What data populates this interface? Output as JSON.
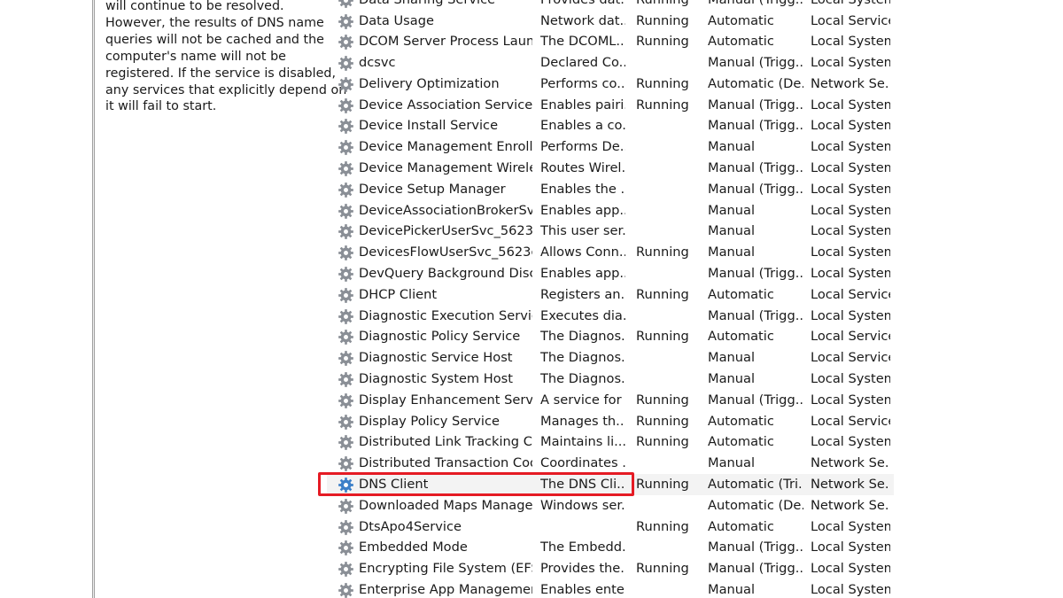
{
  "description_pane": {
    "lines": [
      "will continue to be resolved.",
      "However, the results of DNS name",
      "queries will not be cached and the",
      "computer's name will not be",
      "registered. If the service is disabled,",
      "any services that explicitly depend on",
      "it will fail to start."
    ]
  },
  "colors": {
    "highlight_border": "#e51b24",
    "selected_row_bg": "#f3f3f3",
    "gear_blue": "#3c7fc8",
    "gear_gray": "#8a8f96"
  },
  "services": [
    {
      "name": "Data Sharing Service",
      "description": "Provides dat...",
      "status": "Running",
      "startup": "Manual (Trigg...",
      "logon": "Local System",
      "icon": "gear-icon"
    },
    {
      "name": "Data Usage",
      "description": "Network dat...",
      "status": "Running",
      "startup": "Automatic",
      "logon": "Local Service",
      "icon": "gear-icon"
    },
    {
      "name": "DCOM Server Process Launc...",
      "description": "The DCOML...",
      "status": "Running",
      "startup": "Automatic",
      "logon": "Local System",
      "icon": "gear-icon"
    },
    {
      "name": "dcsvc",
      "description": "Declared Co...",
      "status": "",
      "startup": "Manual (Trigg...",
      "logon": "Local System",
      "icon": "gear-icon"
    },
    {
      "name": "Delivery Optimization",
      "description": "Performs co...",
      "status": "Running",
      "startup": "Automatic (De...",
      "logon": "Network Se...",
      "icon": "gear-icon"
    },
    {
      "name": "Device Association Service",
      "description": "Enables pairi...",
      "status": "Running",
      "startup": "Manual (Trigg...",
      "logon": "Local System",
      "icon": "gear-icon"
    },
    {
      "name": "Device Install Service",
      "description": "Enables a co...",
      "status": "",
      "startup": "Manual (Trigg...",
      "logon": "Local System",
      "icon": "gear-icon"
    },
    {
      "name": "Device Management Enroll...",
      "description": "Performs De...",
      "status": "",
      "startup": "Manual",
      "logon": "Local System",
      "icon": "gear-icon"
    },
    {
      "name": "Device Management Wireles...",
      "description": "Routes Wirel...",
      "status": "",
      "startup": "Manual (Trigg...",
      "logon": "Local System",
      "icon": "gear-icon"
    },
    {
      "name": "Device Setup Manager",
      "description": "Enables the ...",
      "status": "",
      "startup": "Manual (Trigg...",
      "logon": "Local System",
      "icon": "gear-icon"
    },
    {
      "name": "DeviceAssociationBrokerSvc...",
      "description": "Enables app...",
      "status": "",
      "startup": "Manual",
      "logon": "Local System",
      "icon": "gear-icon"
    },
    {
      "name": "DevicePickerUserSvc_5623c",
      "description": "This user ser...",
      "status": "",
      "startup": "Manual",
      "logon": "Local System",
      "icon": "gear-icon"
    },
    {
      "name": "DevicesFlowUserSvc_5623c",
      "description": "Allows Conn...",
      "status": "Running",
      "startup": "Manual",
      "logon": "Local System",
      "icon": "gear-icon"
    },
    {
      "name": "DevQuery Background Disc...",
      "description": "Enables app...",
      "status": "",
      "startup": "Manual (Trigg...",
      "logon": "Local System",
      "icon": "gear-icon"
    },
    {
      "name": "DHCP Client",
      "description": "Registers an...",
      "status": "Running",
      "startup": "Automatic",
      "logon": "Local Service",
      "icon": "gear-icon"
    },
    {
      "name": "Diagnostic Execution Service",
      "description": "Executes dia...",
      "status": "",
      "startup": "Manual (Trigg...",
      "logon": "Local System",
      "icon": "gear-icon"
    },
    {
      "name": "Diagnostic Policy Service",
      "description": "The Diagnos...",
      "status": "Running",
      "startup": "Automatic",
      "logon": "Local Service",
      "icon": "gear-icon"
    },
    {
      "name": "Diagnostic Service Host",
      "description": "The Diagnos...",
      "status": "",
      "startup": "Manual",
      "logon": "Local Service",
      "icon": "gear-icon"
    },
    {
      "name": "Diagnostic System Host",
      "description": "The Diagnos...",
      "status": "",
      "startup": "Manual",
      "logon": "Local System",
      "icon": "gear-icon"
    },
    {
      "name": "Display Enhancement Service",
      "description": "A service for ...",
      "status": "Running",
      "startup": "Manual (Trigg...",
      "logon": "Local System",
      "icon": "gear-icon"
    },
    {
      "name": "Display Policy Service",
      "description": "Manages th...",
      "status": "Running",
      "startup": "Automatic",
      "logon": "Local Service",
      "icon": "gear-icon"
    },
    {
      "name": "Distributed Link Tracking Cli...",
      "description": "Maintains li...",
      "status": "Running",
      "startup": "Automatic",
      "logon": "Local System",
      "icon": "gear-icon"
    },
    {
      "name": "Distributed Transaction Coor...",
      "description": "Coordinates ...",
      "status": "",
      "startup": "Manual",
      "logon": "Network Se...",
      "icon": "gear-icon"
    },
    {
      "name": "DNS Client",
      "description": "The DNS Cli...",
      "status": "Running",
      "startup": "Automatic (Tri...",
      "logon": "Network Se...",
      "icon": "gear-icon",
      "selected": true
    },
    {
      "name": "Downloaded Maps Manager",
      "description": "Windows ser...",
      "status": "",
      "startup": "Automatic (De...",
      "logon": "Network Se...",
      "icon": "gear-icon"
    },
    {
      "name": "DtsApo4Service",
      "description": "",
      "status": "Running",
      "startup": "Automatic",
      "logon": "Local System",
      "icon": "gear-icon"
    },
    {
      "name": "Embedded Mode",
      "description": "The Embedd...",
      "status": "",
      "startup": "Manual (Trigg...",
      "logon": "Local System",
      "icon": "gear-icon"
    },
    {
      "name": "Encrypting File System (EFS)",
      "description": "Provides the...",
      "status": "Running",
      "startup": "Manual (Trigg...",
      "logon": "Local System",
      "icon": "gear-icon"
    },
    {
      "name": "Enterprise App Managemen...",
      "description": "Enables ente...",
      "status": "",
      "startup": "Manual",
      "logon": "Local System",
      "icon": "gear-icon"
    }
  ]
}
